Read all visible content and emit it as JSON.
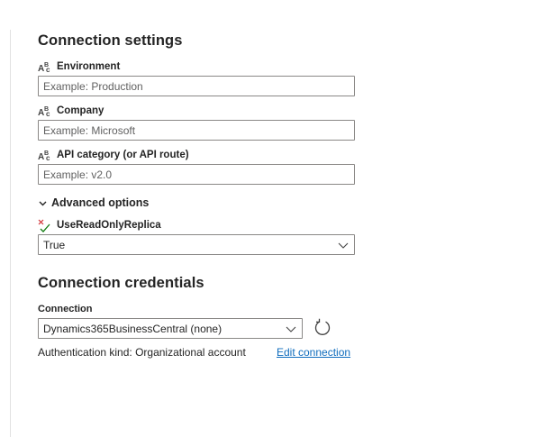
{
  "connection_settings": {
    "title": "Connection settings",
    "fields": [
      {
        "label": "Environment",
        "placeholder": "Example: Production",
        "type_icon": "text-type-icon"
      },
      {
        "label": "Company",
        "placeholder": "Example: Microsoft",
        "type_icon": "text-type-icon"
      },
      {
        "label": "API category (or API route)",
        "placeholder": "Example: v2.0",
        "type_icon": "text-type-icon"
      }
    ],
    "advanced": {
      "label": "Advanced options",
      "expanded": true,
      "option": {
        "label": "UseReadOnlyReplica",
        "type_icon": "boolean-type-icon",
        "value": "True"
      }
    }
  },
  "connection_credentials": {
    "title": "Connection credentials",
    "connection_label": "Connection",
    "connection_value": "Dynamics365BusinessCentral (none)",
    "auth_text": "Authentication kind: Organizational account",
    "edit_link": "Edit connection"
  },
  "colors": {
    "text": "#242424",
    "border": "#8a8886",
    "link": "#0f6cbd",
    "boolean_false": "#d13438",
    "boolean_true": "#107c10"
  }
}
